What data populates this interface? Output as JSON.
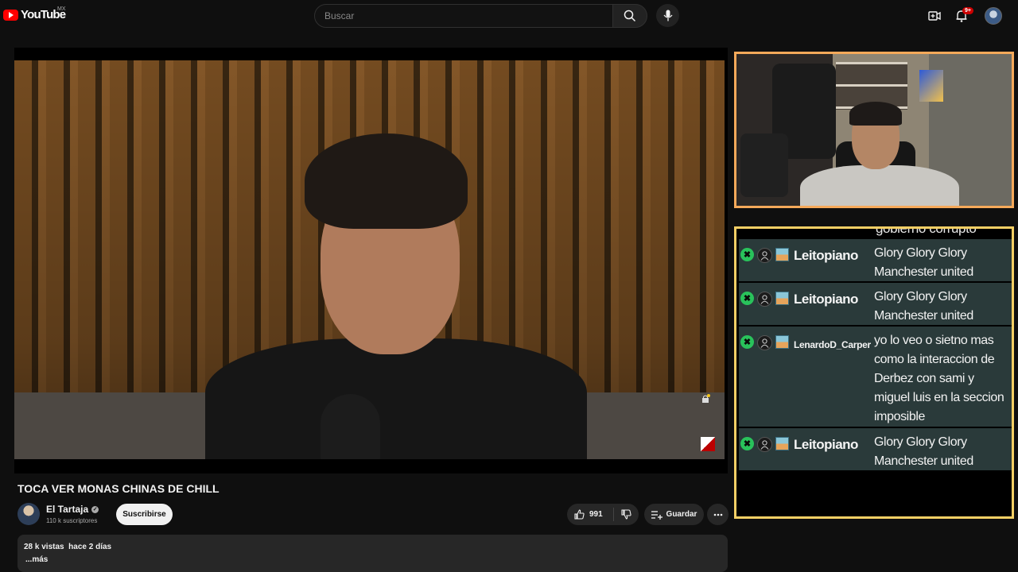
{
  "header": {
    "logo_text": "YouTube",
    "region": "MX",
    "search_placeholder": "Buscar",
    "notification_count": "9+"
  },
  "video": {
    "title": "TOCA VER MONAS CHINAS DE CHILL",
    "channel": "El Tartaja",
    "subscribers": "110 k suscriptores",
    "subscribe_label": "Suscribirse",
    "likes": "991",
    "save_label": "Guardar",
    "views": "28 k vistas",
    "date": "hace 2 días",
    "more_label": "...más"
  },
  "chat": {
    "partial_line": "gobierno corrupto",
    "messages": [
      {
        "user": "Leitopiano",
        "text": "Glory Glory Glory Manchester united"
      },
      {
        "user": "Leitopiano",
        "text": "Glory Glory Glory Manchester united"
      },
      {
        "user": "LenardoD_Carper",
        "text": "yo lo veo o sietno mas como la interaccion de Derbez con sami y miguel luis en la seccion imposible"
      },
      {
        "user": "Leitopiano",
        "text": "Glory Glory Glory Manchester united"
      }
    ]
  },
  "colors": {
    "cam_border": "#f5a95a",
    "chat_border": "#f5cf65",
    "brand_red": "#ff0000",
    "chat_row_bg": "#2a3a3a"
  }
}
